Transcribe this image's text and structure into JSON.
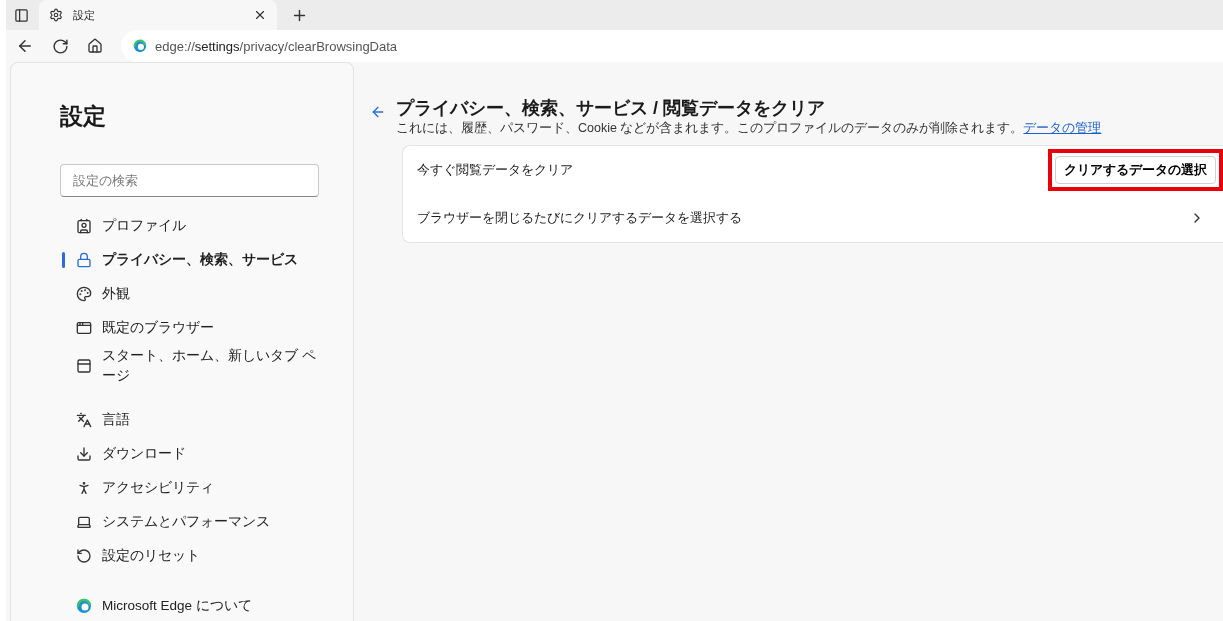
{
  "browser": {
    "tab_title": "設定",
    "address": {
      "scheme": "edge://",
      "host": "settings",
      "path": "/privacy/clearBrowsingData"
    }
  },
  "sidebar": {
    "title": "設定",
    "search": {
      "placeholder": "設定の検索"
    },
    "groups": [
      [
        {
          "label": "プロファイル",
          "selected": false
        },
        {
          "label": "プライバシー、検索、サービス",
          "selected": true
        },
        {
          "label": "外観",
          "selected": false
        },
        {
          "label": "既定のブラウザー",
          "selected": false
        },
        {
          "label": "スタート、ホーム、新しいタブ ページ",
          "selected": false
        }
      ],
      [
        {
          "label": "言語",
          "selected": false
        },
        {
          "label": "ダウンロード",
          "selected": false
        },
        {
          "label": "アクセシビリティ",
          "selected": false
        },
        {
          "label": "システムとパフォーマンス",
          "selected": false
        },
        {
          "label": "設定のリセット",
          "selected": false
        }
      ],
      [
        {
          "label": "Microsoft Edge について",
          "selected": false
        }
      ]
    ]
  },
  "main": {
    "title": "プライバシー、検索、サービス / 閲覧データをクリア",
    "description": "これには、履歴、パスワード、Cookie などが含まれます。このプロファイルのデータのみが削除されます。",
    "manage_link": "データの管理",
    "rows": [
      {
        "kind": "button",
        "label": "今すぐ閲覧データをクリア",
        "button": "クリアするデータの選択",
        "highlighted": true
      },
      {
        "kind": "chevron",
        "label": "ブラウザーを閉じるたびにクリアするデータを選択する"
      }
    ]
  }
}
